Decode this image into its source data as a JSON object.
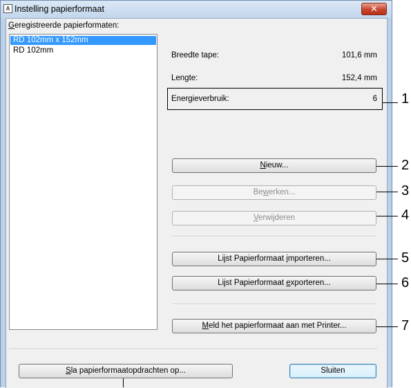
{
  "window": {
    "title": "Instelling papierformaat",
    "icon_label": "A",
    "close_glyph": "✕"
  },
  "paper_list": {
    "label": "Geregistreerde papierformaten:",
    "items": [
      {
        "label": "RD 102mm x 152mm",
        "selected": true
      },
      {
        "label": "RD 102mm",
        "selected": false
      }
    ]
  },
  "info": {
    "width_label": "Breedte tape:",
    "width_value": "101,6 mm",
    "length_label": "Lengte:",
    "length_value": "152,4 mm",
    "energy_label": "Energieverbruik:",
    "energy_value": "6"
  },
  "buttons": {
    "new": "Nieuw...",
    "edit": "Bewerken...",
    "delete": "Verwijderen",
    "import": "Lijst Papierformaat importeren...",
    "export": "Lijst Papierformaat exporteren...",
    "register": "Meld het papierformaat aan met Printer...",
    "save_commands": "Sla papierformaatopdrachten op...",
    "close": "Sluiten"
  },
  "callouts": [
    "1",
    "2",
    "3",
    "4",
    "5",
    "6",
    "7"
  ]
}
